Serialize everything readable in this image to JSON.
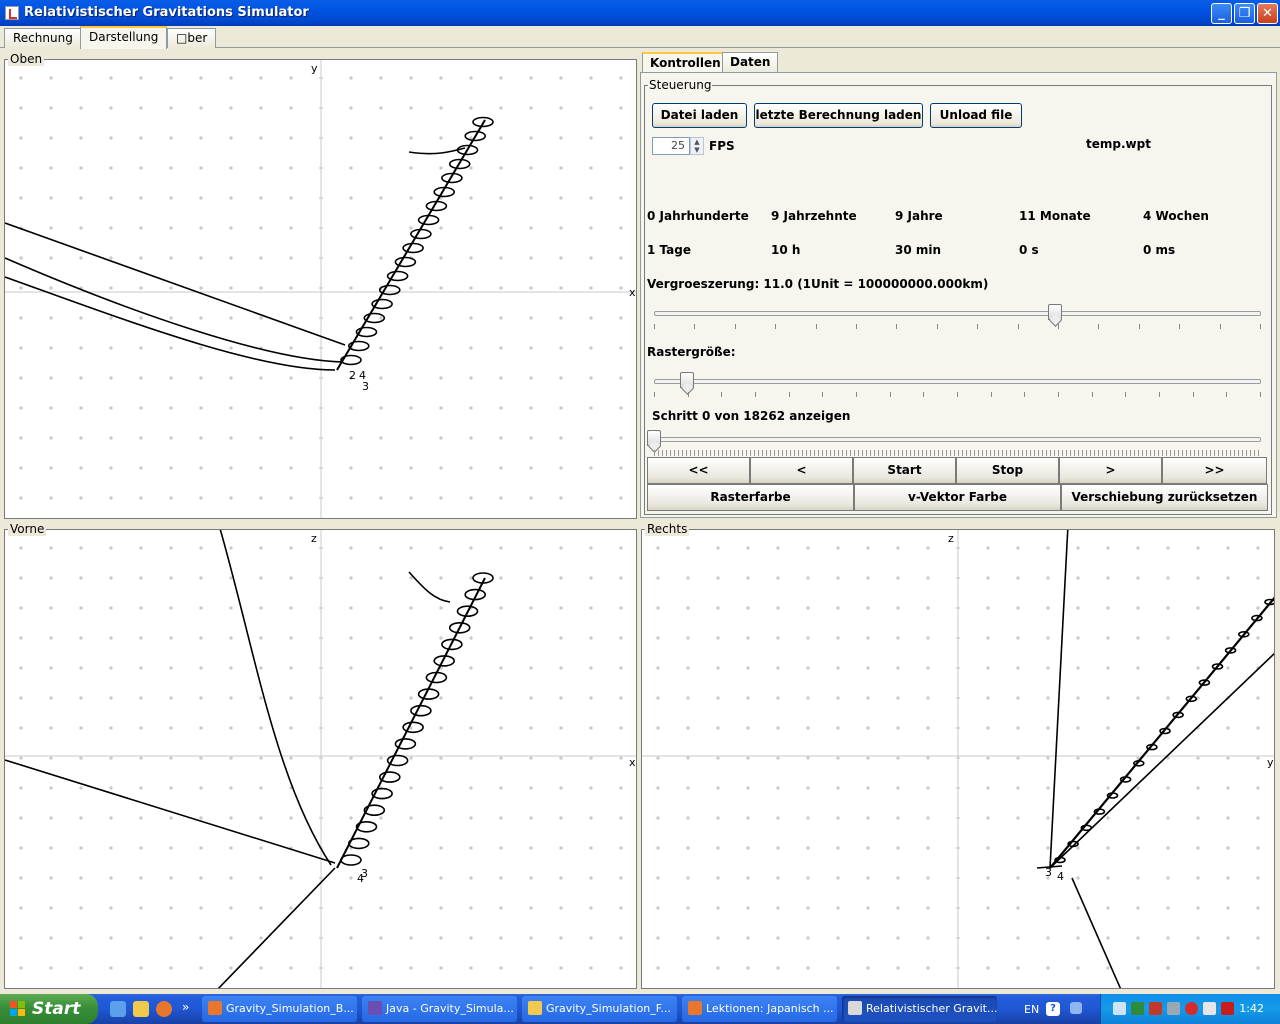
{
  "window": {
    "title": "Relativistischer Gravitations Simulator"
  },
  "menu_tabs": [
    {
      "label": "Rechnung",
      "active": false
    },
    {
      "label": "Darstellung",
      "active": true
    },
    {
      "label": "□ber",
      "active": false
    }
  ],
  "views": {
    "top": {
      "title": "Oben",
      "vertical_axis": "y",
      "horizontal_axis": "x"
    },
    "front": {
      "title": "Vorne",
      "vertical_axis": "z",
      "horizontal_axis": "x"
    },
    "right": {
      "title": "Rechts",
      "vertical_axis": "z",
      "horizontal_axis": "y"
    }
  },
  "controls": {
    "tabs": [
      {
        "label": "Kontrollen",
        "active": true
      },
      {
        "label": "Daten",
        "active": false
      }
    ],
    "group_title": "Steuerung",
    "buttons": {
      "load_file": "Datei laden",
      "load_last": "letzte Berechnung laden",
      "unload": "Unload file"
    },
    "fps_value": "25",
    "fps_label": "FPS",
    "filename": "temp.wpt",
    "time": [
      "0 Jahrhunderte",
      "9 Jahrzehnte",
      "9 Jahre",
      "11 Monate",
      "4 Wochen",
      "1 Tage",
      "10 h",
      "30 min",
      "0 s",
      "0 ms"
    ],
    "zoom_label": "Vergroeszerung: 11.0 (1Unit = 100000000.000km)",
    "zoom_slider_fraction": 0.66,
    "grid_label": "Rastergröße:",
    "grid_slider_fraction": 0.055,
    "step_label": "Schritt 0 von 18262 anzeigen",
    "step_slider_fraction": 0.0,
    "playback": [
      "<<",
      "<",
      "Start",
      "Stop",
      ">",
      ">>"
    ],
    "bottom_buttons": [
      "Rasterfarbe",
      "v-Vektor Farbe",
      "Verschiebung zurücksetzen"
    ]
  },
  "taskbar": {
    "start_label": "Start",
    "chevron": "»",
    "tasks": [
      {
        "label": "Gravity_Simulation_B...",
        "icon_color": "#e8772e",
        "active": false
      },
      {
        "label": "Java - Gravity_Simula...",
        "icon_color": "#6a4fb3",
        "active": false
      },
      {
        "label": "Gravity_Simulation_F...",
        "icon_color": "#f2c94c",
        "active": false
      },
      {
        "label": "Lektionen: Japanisch ...",
        "icon_color": "#e8772e",
        "active": false
      },
      {
        "label": "Relativistischer Gravit...",
        "icon_color": "#d9d9d9",
        "active": true
      }
    ],
    "lang": "EN",
    "clock": "1:42"
  },
  "colors": {
    "titlebar": "#0053e1",
    "taskbar": "#245edb",
    "start_green": "#3a913a",
    "grid_plus": "#bbbbbb",
    "trajectory": "#000000"
  }
}
